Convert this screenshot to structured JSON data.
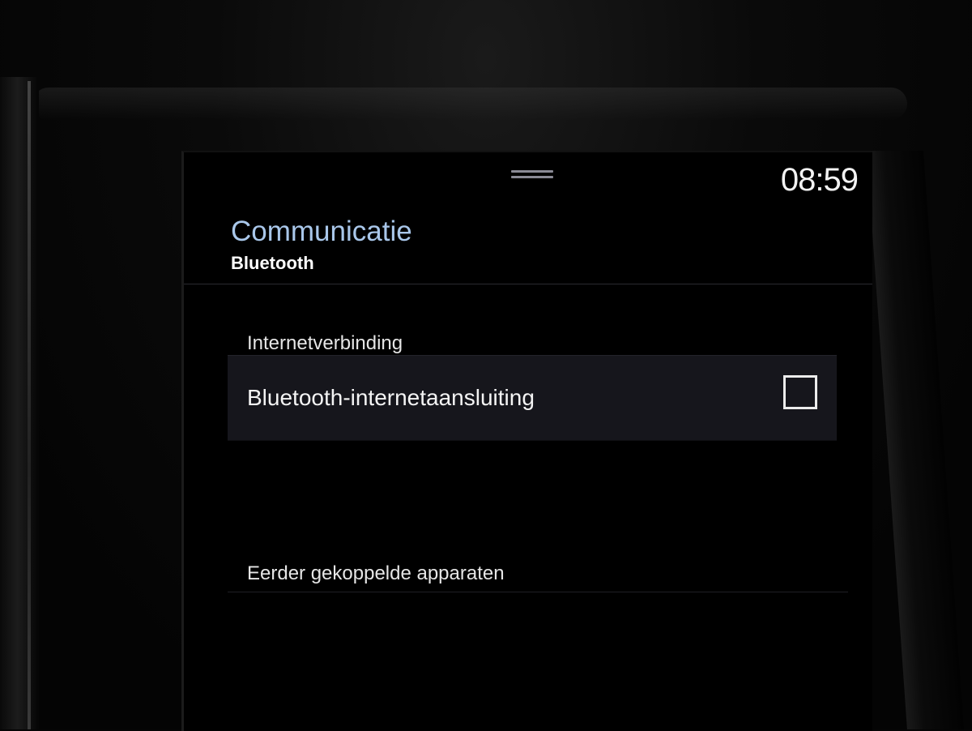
{
  "status_bar": {
    "clock": "08:59"
  },
  "header": {
    "title": "Communicatie",
    "subtitle": "Bluetooth"
  },
  "sections": {
    "internet": {
      "label": "Internetverbinding",
      "rows": [
        {
          "label": "Bluetooth-internetaansluiting",
          "checked": false
        }
      ]
    },
    "paired": {
      "label": "Eerder gekoppelde apparaten"
    }
  },
  "colors": {
    "title": "#a9c7ea",
    "row_background": "#16161c",
    "screen_background": "#000000"
  },
  "icons": {
    "drag_handle": "drag-handle-icon",
    "checkbox": "checkbox-unchecked-icon"
  }
}
